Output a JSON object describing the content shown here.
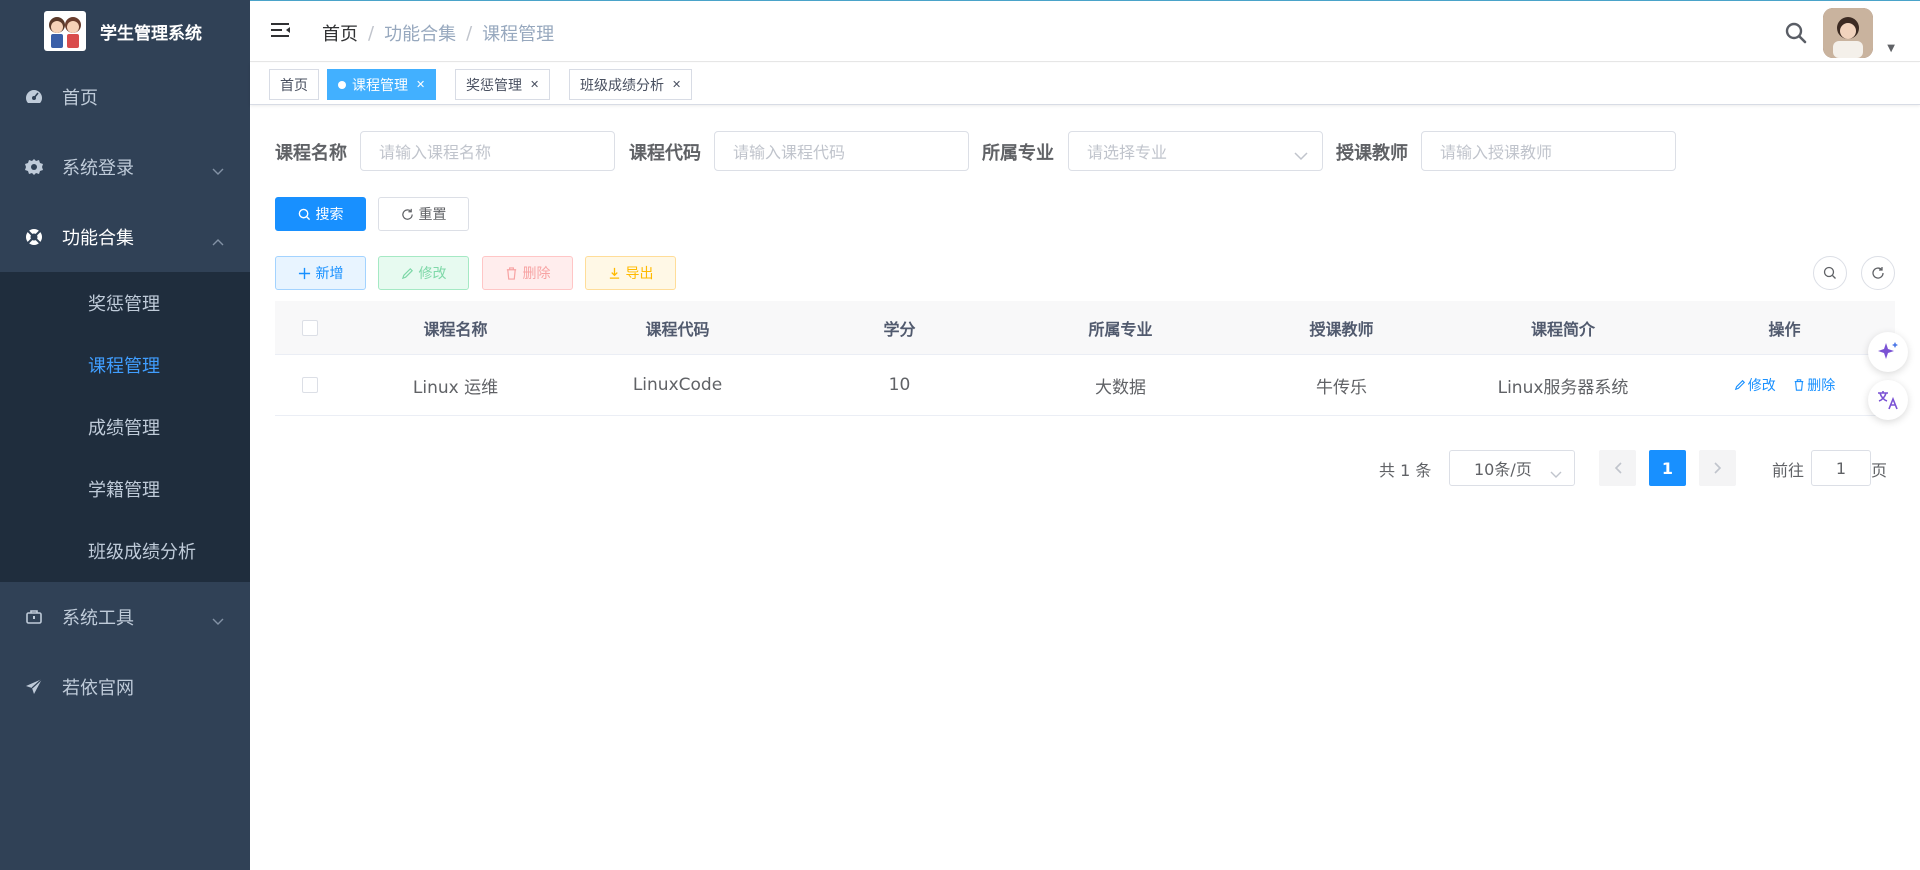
{
  "app": {
    "title": "学生管理系统"
  },
  "sidebar": {
    "items": [
      {
        "label": "首页",
        "icon": "dashboard-icon"
      },
      {
        "label": "系统登录",
        "icon": "gear-icon"
      },
      {
        "label": "功能合集",
        "icon": "lifebuoy-icon"
      },
      {
        "label": "系统工具",
        "icon": "toolbox-icon"
      },
      {
        "label": "若依官网",
        "icon": "send-icon"
      }
    ],
    "submenu": [
      "奖惩管理",
      "课程管理",
      "成绩管理",
      "学籍管理",
      "班级成绩分析"
    ],
    "active_sub": "课程管理"
  },
  "breadcrumb": [
    "首页",
    "功能合集",
    "课程管理"
  ],
  "tags": [
    {
      "label": "首页"
    },
    {
      "label": "课程管理",
      "active": true
    },
    {
      "label": "奖惩管理"
    },
    {
      "label": "班级成绩分析"
    }
  ],
  "form": {
    "course_name_label": "课程名称",
    "course_name_placeholder": "请输入课程名称",
    "course_code_label": "课程代码",
    "course_code_placeholder": "请输入课程代码",
    "major_label": "所属专业",
    "major_placeholder": "请选择专业",
    "teacher_label": "授课教师",
    "teacher_placeholder": "请输入授课教师",
    "search_btn": "搜索",
    "reset_btn": "重置"
  },
  "toolbar": {
    "add": "新增",
    "edit": "修改",
    "delete": "删除",
    "export": "导出"
  },
  "table": {
    "columns": [
      "课程名称",
      "课程代码",
      "学分",
      "所属专业",
      "授课教师",
      "课程简介",
      "操作"
    ],
    "rows": [
      {
        "name": "Linux 运维",
        "code": "LinuxCode",
        "credit": "10",
        "major": "大数据",
        "teacher": "牛传乐",
        "intro": "Linux服务器系统",
        "edit": "修改",
        "delete": "删除"
      }
    ]
  },
  "pagination": {
    "total": "共 1 条",
    "page_size": "10条/页",
    "current": "1",
    "goto_label": "前往",
    "goto_value": "1",
    "goto_unit": "页"
  },
  "colors": {
    "sidebar_bg": "#304156",
    "submenu_bg": "#1f2d3d",
    "primary": "#1890ff",
    "active_tag": "#42b0ff"
  }
}
